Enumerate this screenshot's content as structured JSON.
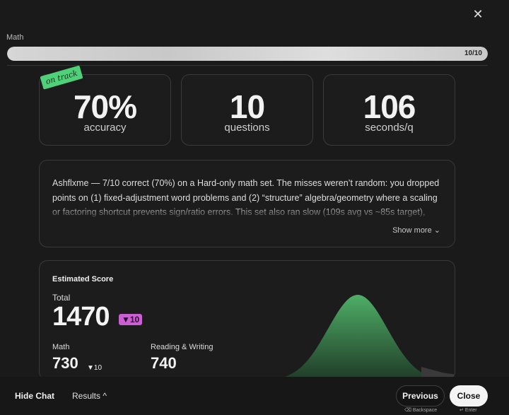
{
  "header": {
    "close_icon": "close-icon",
    "subject": "Math",
    "progress_count": "10/10",
    "progress_fraction": 1.0
  },
  "stats": {
    "badge": "on track",
    "accuracy": {
      "value": "70%",
      "label": "accuracy"
    },
    "questions": {
      "value": "10",
      "label": "questions"
    },
    "seconds": {
      "value": "106",
      "label": "seconds/q"
    }
  },
  "summary": {
    "text": "Ashflxme — 7/10 correct (70%) on a Hard-only math set. The misses weren’t random: you dropped points on (1) fixed-adjustment word problems and (2) “structure” algebra/geometry where a scaling or factoring shortcut prevents sign/ratio errors. This set also ran slow (109s avg vs ~85s target),",
    "show_more": "Show more",
    "chevron_icon": "chevron-down-icon"
  },
  "score": {
    "title": "Estimated Score",
    "total_label": "Total",
    "total_value": "1470",
    "total_delta": "▼10",
    "math_label": "Math",
    "math_value": "730",
    "math_delta": "▼10",
    "rw_label": "Reading & Writing",
    "rw_value": "740",
    "curve_color": "#4fae67"
  },
  "footer": {
    "hide_chat": "Hide Chat",
    "results": "Results ^",
    "previous": "Previous",
    "close": "Close",
    "backspace_hint": "Backspace",
    "enter_hint": "Enter"
  }
}
